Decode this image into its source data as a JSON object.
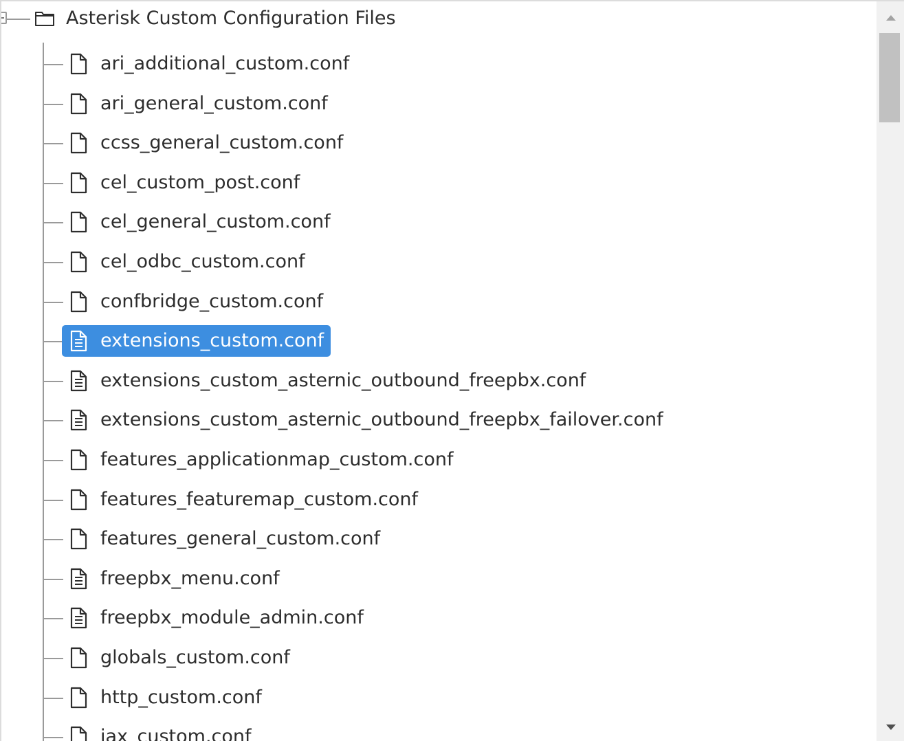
{
  "tree": {
    "root": {
      "label": "Asterisk Custom Configuration Files",
      "icon": "folder-icon",
      "expanded": true
    },
    "items": [
      {
        "label": "ari_additional_custom.conf",
        "icon": "file-icon",
        "selected": false
      },
      {
        "label": "ari_general_custom.conf",
        "icon": "file-icon",
        "selected": false
      },
      {
        "label": "ccss_general_custom.conf",
        "icon": "file-icon",
        "selected": false
      },
      {
        "label": "cel_custom_post.conf",
        "icon": "file-icon",
        "selected": false
      },
      {
        "label": "cel_general_custom.conf",
        "icon": "file-icon",
        "selected": false
      },
      {
        "label": "cel_odbc_custom.conf",
        "icon": "file-icon",
        "selected": false
      },
      {
        "label": "confbridge_custom.conf",
        "icon": "file-icon",
        "selected": false
      },
      {
        "label": "extensions_custom.conf",
        "icon": "file-text-icon",
        "selected": true
      },
      {
        "label": "extensions_custom_asternic_outbound_freepbx.conf",
        "icon": "file-text-icon",
        "selected": false
      },
      {
        "label": "extensions_custom_asternic_outbound_freepbx_failover.conf",
        "icon": "file-text-icon",
        "selected": false
      },
      {
        "label": "features_applicationmap_custom.conf",
        "icon": "file-icon",
        "selected": false
      },
      {
        "label": "features_featuremap_custom.conf",
        "icon": "file-icon",
        "selected": false
      },
      {
        "label": "features_general_custom.conf",
        "icon": "file-icon",
        "selected": false
      },
      {
        "label": "freepbx_menu.conf",
        "icon": "file-text-icon",
        "selected": false
      },
      {
        "label": "freepbx_module_admin.conf",
        "icon": "file-text-icon",
        "selected": false
      },
      {
        "label": "globals_custom.conf",
        "icon": "file-icon",
        "selected": false
      },
      {
        "label": "http_custom.conf",
        "icon": "file-icon",
        "selected": false
      },
      {
        "label": "iax_custom.conf",
        "icon": "file-icon",
        "selected": false
      }
    ]
  },
  "colors": {
    "selection": "#3d8ee0",
    "text": "#2d2d2d",
    "selected_text": "#ffffff",
    "tree_lines": "#9a9a9a"
  }
}
